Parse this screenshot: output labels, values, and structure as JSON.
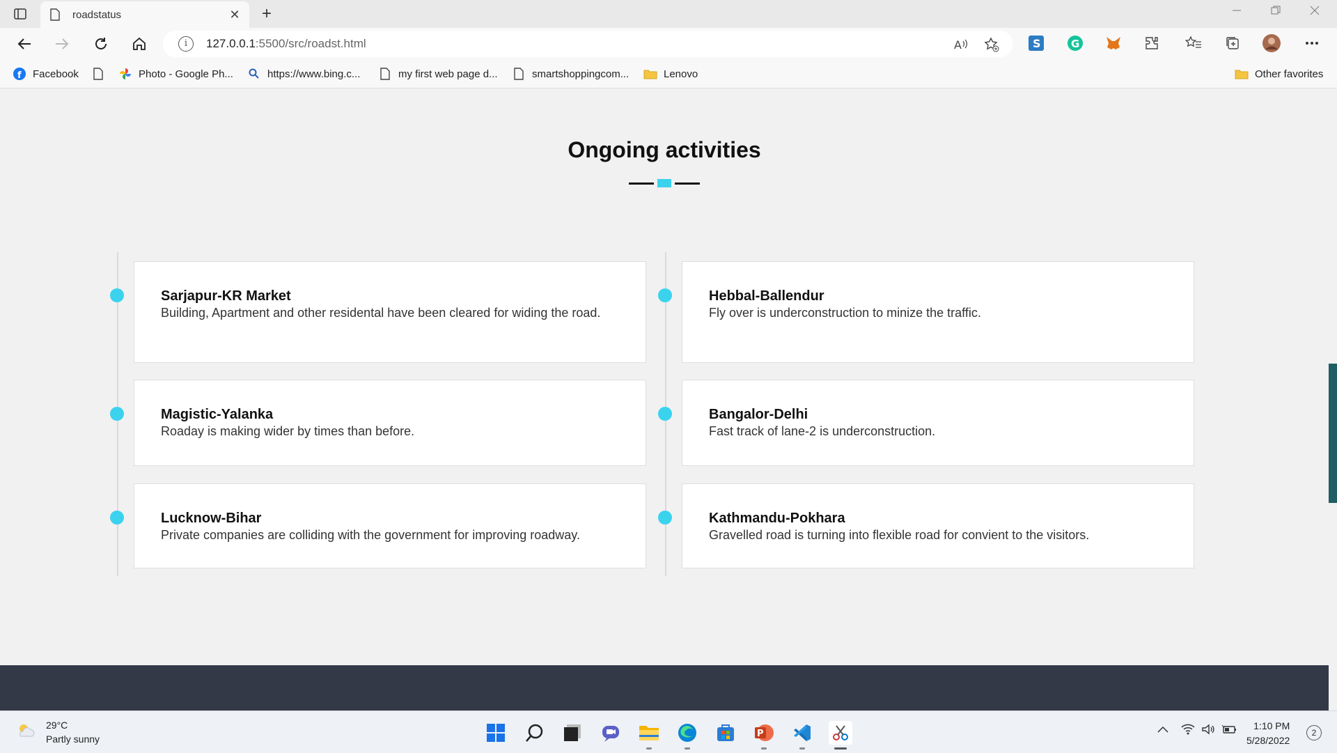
{
  "browser": {
    "tab_title": "roadstatus",
    "tab_close": "✕",
    "new_tab": "+",
    "url_host": "127.0.0.1",
    "url_path": ":5500/src/roadst.html",
    "info_glyph": "i"
  },
  "favorites": [
    {
      "label": "Facebook",
      "icon": "facebook-icon"
    },
    {
      "label": "",
      "icon": "page-icon"
    },
    {
      "label": "Photo - Google Ph...",
      "icon": "google-photos-icon"
    },
    {
      "label": "https://www.bing.c...",
      "icon": "search-icon"
    },
    {
      "label": "my first web page d...",
      "icon": "page-icon"
    },
    {
      "label": "smartshoppingcom...",
      "icon": "page-icon"
    },
    {
      "label": "Lenovo",
      "icon": "folder-icon"
    }
  ],
  "other_favorites": "Other favorites",
  "page": {
    "heading": "Ongoing activities",
    "accent_color": "#3bd2ee",
    "activities": [
      {
        "title": "Sarjapur-KR Market",
        "desc": "Building, Apartment and other residental have been cleared for widing the road."
      },
      {
        "title": "Hebbal-Ballendur",
        "desc": "Fly over is underconstruction to minize the traffic."
      },
      {
        "title": "Magistic-Yalanka",
        "desc": "Roaday is making wider by times than before."
      },
      {
        "title": "Bangalor-Delhi",
        "desc": "Fast track of lane-2 is underconstruction."
      },
      {
        "title": "Lucknow-Bihar",
        "desc": "Private companies are colliding with the government for improving roadway."
      },
      {
        "title": "Kathmandu-Pokhara",
        "desc": "Gravelled road is turning into flexible road for convient to the visitors."
      }
    ],
    "footer_color": "#333946"
  },
  "taskbar": {
    "weather_temp": "29°C",
    "weather_desc": "Partly sunny",
    "time": "1:10 PM",
    "date": "5/28/2022",
    "notifications": "2"
  }
}
